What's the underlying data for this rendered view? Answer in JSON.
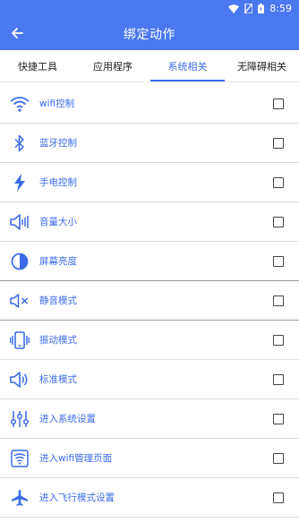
{
  "status_bar": {
    "time": "8:59"
  },
  "header": {
    "title": "绑定动作"
  },
  "tabs": [
    {
      "label": "快捷工具",
      "active": false
    },
    {
      "label": "应用程序",
      "active": false
    },
    {
      "label": "系统相关",
      "active": true
    },
    {
      "label": "无障碍相关",
      "active": false
    }
  ],
  "items": [
    {
      "label": "wifi控制",
      "icon": "wifi-icon",
      "checked": false
    },
    {
      "label": "蓝牙控制",
      "icon": "bluetooth-icon",
      "checked": false
    },
    {
      "label": "手电控制",
      "icon": "flashlight-icon",
      "checked": false
    },
    {
      "label": "音量大小",
      "icon": "volume-icon",
      "checked": false
    },
    {
      "label": "屏幕亮度",
      "icon": "brightness-icon",
      "checked": false
    },
    {
      "label": "静音模式",
      "icon": "mute-icon",
      "checked": false
    },
    {
      "label": "振动模式",
      "icon": "vibrate-icon",
      "checked": false
    },
    {
      "label": "标准模式",
      "icon": "sound-icon",
      "checked": false
    },
    {
      "label": "进入系统设置",
      "icon": "sliders-icon",
      "checked": false
    },
    {
      "label": "进入wifi管理页面",
      "icon": "wifi-settings-icon",
      "checked": false
    },
    {
      "label": "进入飞行模式设置",
      "icon": "airplane-icon",
      "checked": false
    }
  ],
  "colors": {
    "primary": "#4a78f0",
    "accent": "#3b6be8"
  }
}
